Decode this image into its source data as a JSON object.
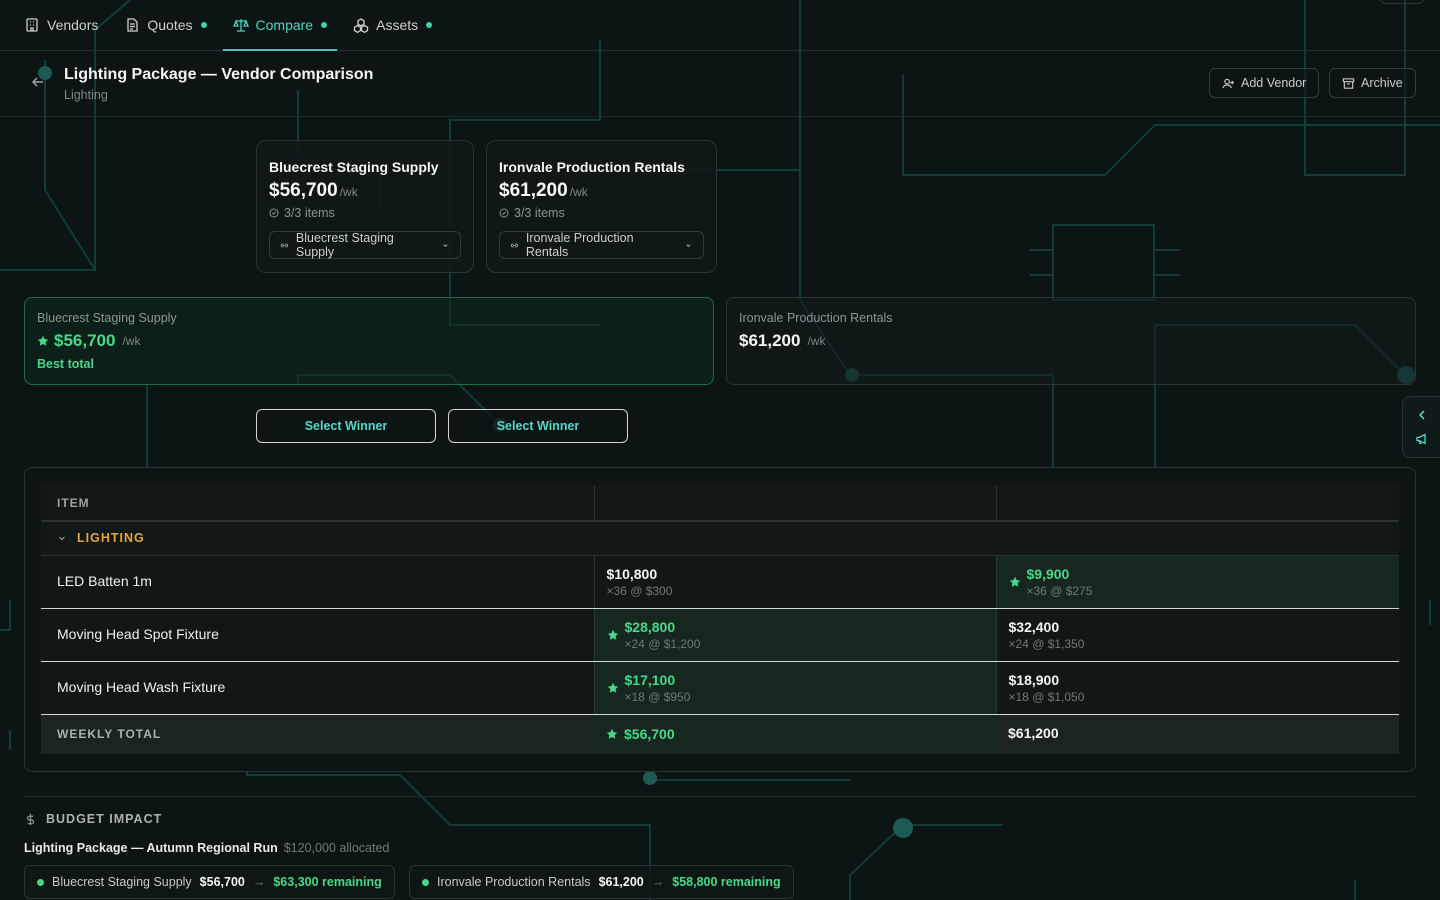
{
  "nav": {
    "tabs": [
      {
        "label": "Vendors",
        "icon": "building-icon"
      },
      {
        "label": "Quotes",
        "icon": "document-icon"
      },
      {
        "label": "Compare",
        "icon": "scale-icon"
      },
      {
        "label": "Assets",
        "icon": "boxes-icon"
      }
    ],
    "active_tab": "Compare"
  },
  "header": {
    "title": "Lighting Package — Vendor Comparison",
    "subtitle": "Lighting",
    "add_vendor": "Add Vendor",
    "archive": "Archive"
  },
  "vendors": [
    {
      "name": "Bluecrest Staging Supply",
      "price": "$56,700",
      "unit": "/wk",
      "items": "3/3 items",
      "select": "Bluecrest Staging Supply"
    },
    {
      "name": "Ironvale Production Rentals",
      "price": "$61,200",
      "unit": "/wk",
      "items": "3/3 items",
      "select": "Ironvale Production Rentals"
    }
  ],
  "summary": [
    {
      "vendor": "Bluecrest Staging Supply",
      "price": "$56,700",
      "unit": "/wk",
      "badge": "Best total"
    },
    {
      "vendor": "Ironvale Production Rentals",
      "price": "$61,200",
      "unit": "/wk"
    }
  ],
  "select_winner": "Select Winner",
  "table": {
    "item_header": "ITEM",
    "group": "LIGHTING",
    "rows": [
      {
        "name": "LED Batten 1m",
        "v1": {
          "amount": "$10,800",
          "detail": "×36 @ $300"
        },
        "v2": {
          "amount": "$9,900",
          "detail": "×36 @ $275"
        },
        "winner": 2
      },
      {
        "name": "Moving Head Spot Fixture",
        "v1": {
          "amount": "$28,800",
          "detail": "×24 @ $1,200"
        },
        "v2": {
          "amount": "$32,400",
          "detail": "×24 @ $1,350"
        },
        "winner": 1
      },
      {
        "name": "Moving Head Wash Fixture",
        "v1": {
          "amount": "$17,100",
          "detail": "×18 @ $950"
        },
        "v2": {
          "amount": "$18,900",
          "detail": "×18 @ $1,050"
        },
        "winner": 1
      }
    ],
    "total_label": "WEEKLY TOTAL",
    "total_v1": "$56,700",
    "total_v2": "$61,200"
  },
  "budget": {
    "header": "BUDGET IMPACT",
    "name": "Lighting Package — Autumn Regional Run",
    "allocated": "$120,000 allocated",
    "chips": [
      {
        "vendor": "Bluecrest Staging Supply",
        "price": "$56,700",
        "remaining": "$63,300 remaining"
      },
      {
        "vendor": "Ironvale Production Rentals",
        "price": "$61,200",
        "remaining": "$58,800 remaining"
      }
    ]
  },
  "colors": {
    "accent": "#4ed3c1",
    "best": "#49d889",
    "group": "#e8a33a",
    "bg": "#0d1414"
  }
}
